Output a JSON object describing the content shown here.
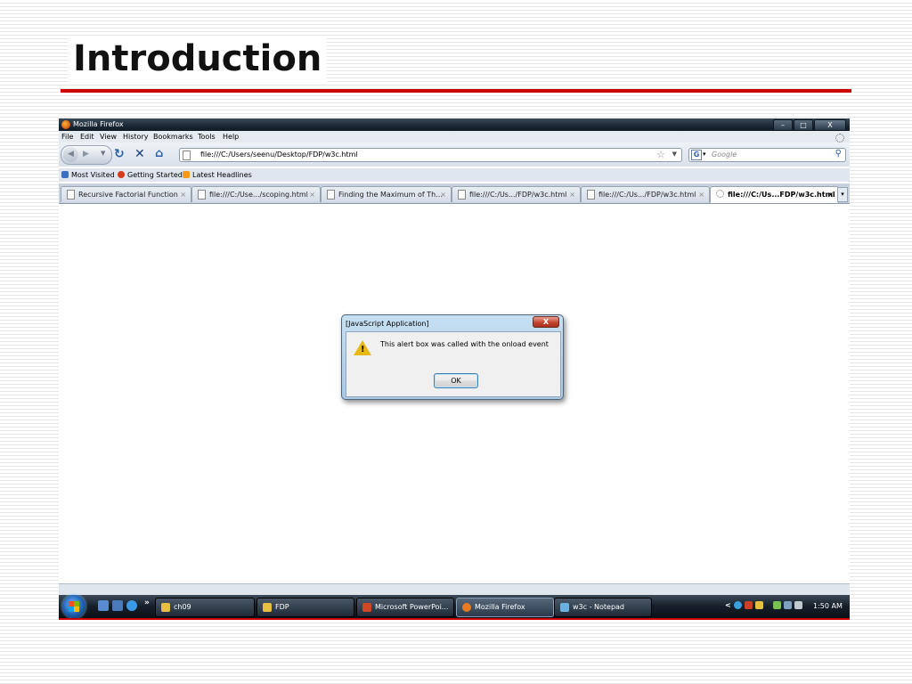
{
  "slide": {
    "title": "Introduction"
  },
  "window": {
    "title": "Mozilla Firefox",
    "controls": [
      "–",
      "□",
      "X"
    ]
  },
  "menu": {
    "items": [
      "File",
      "Edit",
      "View",
      "History",
      "Bookmarks",
      "Tools",
      "Help"
    ]
  },
  "nav": {
    "url": "file:///C:/Users/seenu/Desktop/FDP/w3c.html",
    "search_placeholder": "Google"
  },
  "bookmarks": {
    "items": [
      "Most Visited",
      "Getting Started",
      "Latest Headlines"
    ]
  },
  "tabs": [
    {
      "label": "Recursive Factorial Function"
    },
    {
      "label": "file:///C:/Use.../scoping.html"
    },
    {
      "label": "Finding the Maximum of Th..."
    },
    {
      "label": "file:///C:/Us.../FDP/w3c.html"
    },
    {
      "label": "file:///C:/Us.../FDP/w3c.html"
    },
    {
      "label": "file:///C:/Us...FDP/w3c.html",
      "active": true
    }
  ],
  "tab_close_glyph": "×",
  "dialog": {
    "title": "[JavaScript Application]",
    "close": "X",
    "message": "This alert box was called with the onload event",
    "ok": "OK"
  },
  "taskbar": {
    "overflow": "»",
    "buttons": [
      {
        "label": "ch09",
        "icon_color": "#e8c040"
      },
      {
        "label": "FDP",
        "icon_color": "#e8c040"
      },
      {
        "label": "Microsoft PowerPoi...",
        "icon_color": "#d24726"
      },
      {
        "label": "Mozilla Firefox",
        "icon_color": "#e87a20",
        "active": true
      },
      {
        "label": "w3c - Notepad",
        "icon_color": "#6ab0e0"
      }
    ],
    "clock": "1:50 AM",
    "tray_chevron": "<"
  },
  "colors": {
    "accent_rule": "#cc0000",
    "alert_icon": "#e8b818"
  }
}
